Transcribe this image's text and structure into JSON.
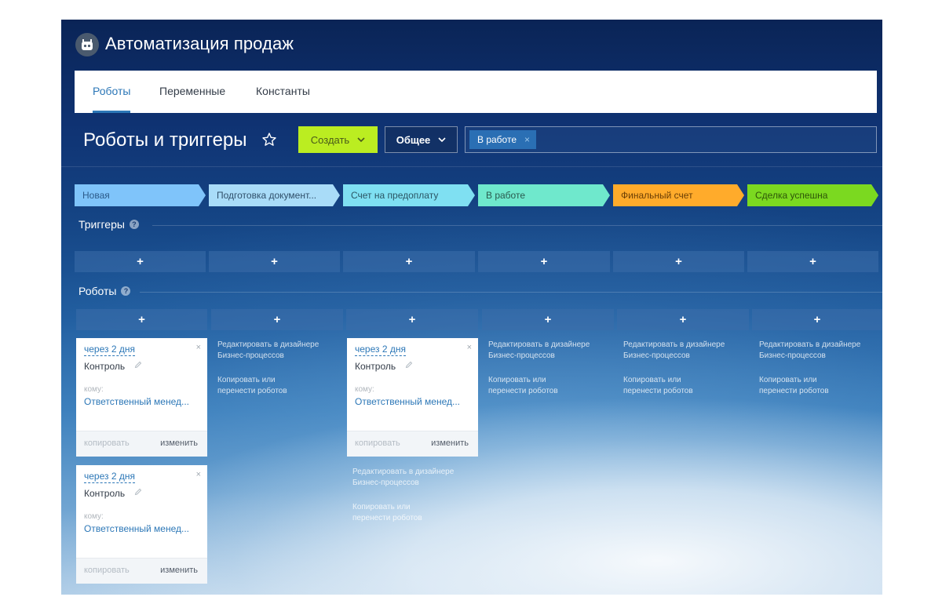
{
  "app": {
    "title": "Автоматизация продаж",
    "logo_icon": "robot-icon"
  },
  "tabs": [
    {
      "label": "Роботы",
      "active": true
    },
    {
      "label": "Переменные",
      "active": false
    },
    {
      "label": "Константы",
      "active": false
    }
  ],
  "toolbar": {
    "page_title": "Роботы и триггеры",
    "create_label": "Создать",
    "general_label": "Общее",
    "filter_chip": "В работе",
    "filter_chip_close": "×"
  },
  "stages": [
    {
      "label": "Новая",
      "color": "#7fc4fa",
      "text_color": "#2c5b8a"
    },
    {
      "label": "Подготовка документ...",
      "color": "#a9dcf8",
      "text_color": "#2f4f6a"
    },
    {
      "label": "Счет на предоплату",
      "color": "#7fe0f2",
      "text_color": "#2b5564"
    },
    {
      "label": "В работе",
      "color": "#6fe8cc",
      "text_color": "#2a5a4e"
    },
    {
      "label": "Финальный счет",
      "color": "#ffab2b",
      "text_color": "#6a3e05"
    },
    {
      "label": "Сделка успешна",
      "color": "#7bd920",
      "text_color": "#2e5508"
    }
  ],
  "sections": {
    "triggers": "Триггеры",
    "robots": "Роботы",
    "help_glyph": "?",
    "add_glyph": "+"
  },
  "robot_card": {
    "delay": "через 2 дня",
    "name": "Контроль",
    "to_label": "кому:",
    "responsible": "Ответственный менед...",
    "copy": "копировать",
    "edit": "изменить",
    "close": "×"
  },
  "bp_links": {
    "edit_designer": [
      "Редактировать в дизайнере",
      "Бизнес-процессов"
    ],
    "copy_move": [
      "Копировать или",
      "перенести роботов"
    ]
  }
}
